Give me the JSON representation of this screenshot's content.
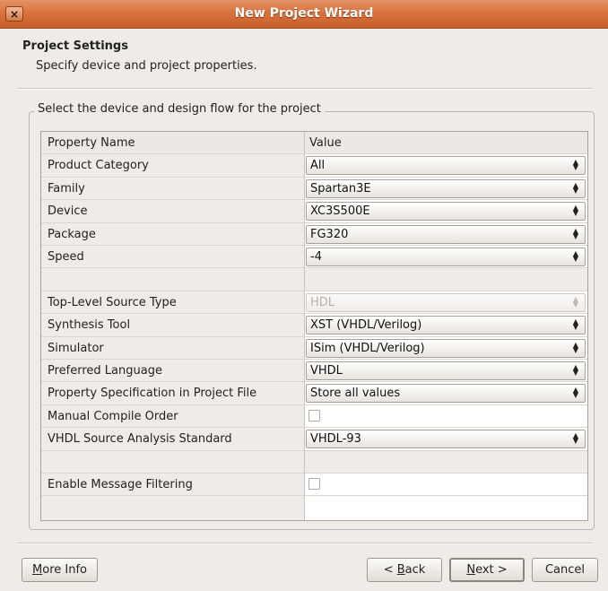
{
  "window": {
    "title": "New Project Wizard",
    "close_glyph": "×"
  },
  "header": {
    "title": "Project Settings",
    "subtitle": "Specify device and project properties."
  },
  "group": {
    "legend": "Select the device and design flow for the project"
  },
  "table": {
    "col_property": "Property Name",
    "col_value": "Value",
    "rows": [
      {
        "label": "Product Category",
        "value": "All"
      },
      {
        "label": "Family",
        "value": "Spartan3E"
      },
      {
        "label": "Device",
        "value": "XC3S500E"
      },
      {
        "label": "Package",
        "value": "FG320"
      },
      {
        "label": "Speed",
        "value": "-4"
      },
      {
        "label": "Top-Level Source Type",
        "value": "HDL"
      },
      {
        "label": "Synthesis Tool",
        "value": "XST (VHDL/Verilog)"
      },
      {
        "label": "Simulator",
        "value": "ISim (VHDL/Verilog)"
      },
      {
        "label": "Preferred Language",
        "value": "VHDL"
      },
      {
        "label": "Property Specification in Project File",
        "value": "Store all values"
      },
      {
        "label": "Manual Compile Order",
        "checked": false
      },
      {
        "label": "VHDL Source Analysis Standard",
        "value": "VHDL-93"
      },
      {
        "label": "Enable Message Filtering",
        "checked": false
      }
    ]
  },
  "buttons": {
    "more_info": {
      "mnemonic": "M",
      "rest": "ore Info"
    },
    "back": {
      "prefix": "< ",
      "mnemonic": "B",
      "rest": "ack"
    },
    "next": {
      "mnemonic": "N",
      "rest": "ext >"
    },
    "cancel": "Cancel"
  },
  "icons": {
    "combo_arrows": "updown-arrows-icon",
    "close": "close-icon"
  }
}
